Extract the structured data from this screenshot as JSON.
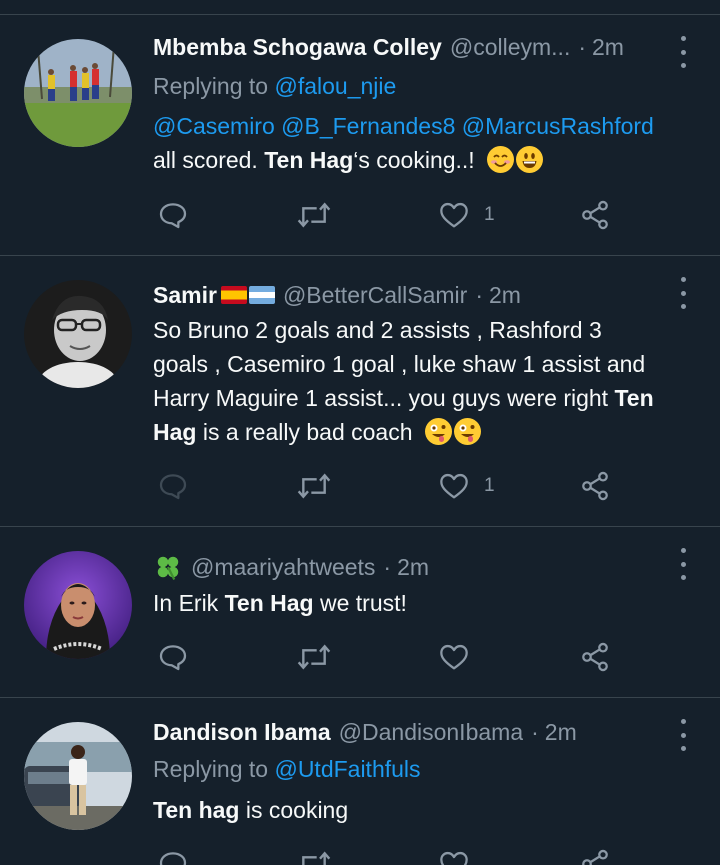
{
  "tweets": [
    {
      "name": "Mbemba Schogawa Colley",
      "handle": "@colleym...",
      "sep": "·",
      "time": "2m",
      "reply_prefix": "Replying to ",
      "reply_to": "@falou_njie",
      "mentions": "@Casemiro @B_Fernandes8 @MarcusRashford",
      "text_1": "all scored. ",
      "text_bold": "Ten Hag",
      "text_2": "‘s cooking..!",
      "likes": "1"
    },
    {
      "name": "Samir",
      "handle": "@BetterCallSamir",
      "sep": "·",
      "time": "2m",
      "lines": [
        "So Bruno 2 goals and 2 assists , Rashford 3",
        "goals , Casemiro 1 goal , luke shaw 1 assist and",
        "Harry Maguire 1 assist... you guys were right "
      ],
      "bold_1": "Ten",
      "bold_2": "Hag",
      "text_end": " is a really bad coach",
      "likes": "1"
    },
    {
      "handle": "@maariyahtweets",
      "sep": "·",
      "time": "2m",
      "text_1": "In Erik ",
      "text_bold": "Ten Hag",
      "text_2": " we trust!"
    },
    {
      "name": "Dandison Ibama",
      "handle": "@DandisonIbama",
      "sep": "·",
      "time": "2m",
      "reply_prefix": "Replying to ",
      "reply_to": "@UtdFaithfuls",
      "text_bold": "Ten hag",
      "text_2": " is cooking"
    }
  ],
  "icons": {
    "reply": "speech-bubble",
    "retweet": "retweet-arrows",
    "like": "heart",
    "share": "share-nodes",
    "more": "vertical-ellipsis"
  },
  "colors": {
    "background": "#15202b",
    "text": "#f7f9f9",
    "muted": "#8b98a5",
    "link": "#1d9bf0",
    "divider": "#38444d"
  }
}
